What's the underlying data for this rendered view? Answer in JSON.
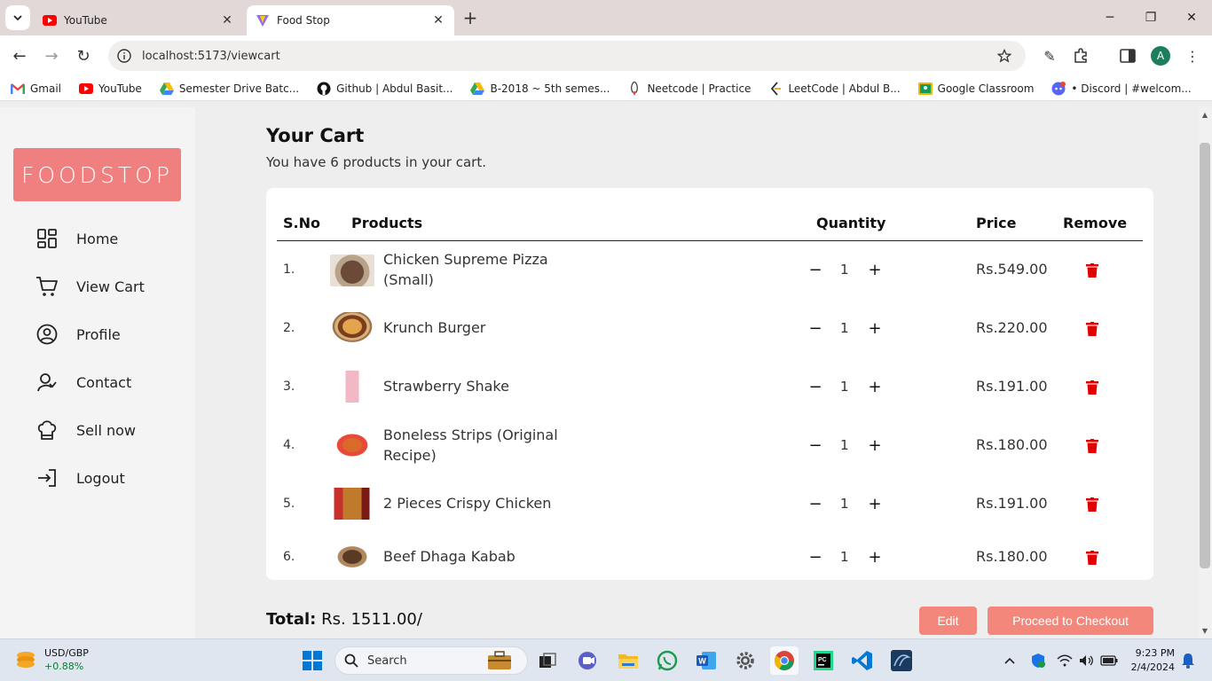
{
  "browser": {
    "tabs": [
      {
        "title": "YouTube",
        "active": false
      },
      {
        "title": "Food Stop",
        "active": true
      }
    ],
    "url": "localhost:5173/viewcart",
    "profile_initial": "A",
    "bookmarks": [
      {
        "label": "Gmail",
        "icon": "gmail-icon"
      },
      {
        "label": "YouTube",
        "icon": "youtube-icon"
      },
      {
        "label": "Semester Drive Batc...",
        "icon": "drive-icon"
      },
      {
        "label": "Github | Abdul Basit...",
        "icon": "github-icon"
      },
      {
        "label": "B-2018 ~ 5th semes...",
        "icon": "drive-icon"
      },
      {
        "label": "Neetcode | Practice",
        "icon": "rocket-icon"
      },
      {
        "label": "LeetCode | Abdul B...",
        "icon": "leetcode-icon"
      },
      {
        "label": "Google Classroom",
        "icon": "classroom-icon"
      },
      {
        "label": "• Discord | #welcom...",
        "icon": "discord-icon"
      }
    ]
  },
  "sidebar": {
    "logo": "FOODSTOP",
    "items": [
      {
        "label": "Home",
        "icon": "grid-icon"
      },
      {
        "label": "View Cart",
        "icon": "cart-icon"
      },
      {
        "label": "Profile",
        "icon": "user-circle-icon"
      },
      {
        "label": "Contact",
        "icon": "contact-icon"
      },
      {
        "label": "Sell now",
        "icon": "chef-hat-icon"
      },
      {
        "label": "Logout",
        "icon": "logout-icon"
      }
    ]
  },
  "cart": {
    "title": "Your Cart",
    "subtitle": "You have 6 products in your cart.",
    "headers": {
      "sno": "S.No",
      "products": "Products",
      "quantity": "Quantity",
      "price": "Price",
      "remove": "Remove"
    },
    "items": [
      {
        "sno": "1.",
        "name": "Chicken Supreme Pizza (Small)",
        "qty": "1",
        "price": "Rs.549.00"
      },
      {
        "sno": "2.",
        "name": "Krunch Burger",
        "qty": "1",
        "price": "Rs.220.00"
      },
      {
        "sno": "3.",
        "name": "Strawberry Shake",
        "qty": "1",
        "price": "Rs.191.00"
      },
      {
        "sno": "4.",
        "name": "Boneless Strips (Original Recipe)",
        "qty": "1",
        "price": "Rs.180.00"
      },
      {
        "sno": "5.",
        "name": "2 Pieces Crispy Chicken",
        "qty": "1",
        "price": "Rs.191.00"
      },
      {
        "sno": "6.",
        "name": "Beef Dhaga Kabab",
        "qty": "1",
        "price": "Rs.180.00"
      }
    ],
    "total_label": "Total:",
    "total_value": "Rs. 1511.00/",
    "edit_label": "Edit",
    "checkout_label": "Proceed to Checkout"
  },
  "taskbar": {
    "ticker_name": "USD/GBP",
    "ticker_change": "+0.88%",
    "search_label": "Search",
    "time": "9:23 PM",
    "date": "2/4/2024"
  },
  "colors": {
    "accent": "#f08080",
    "button": "#f4877b",
    "trash": "#e00000"
  }
}
